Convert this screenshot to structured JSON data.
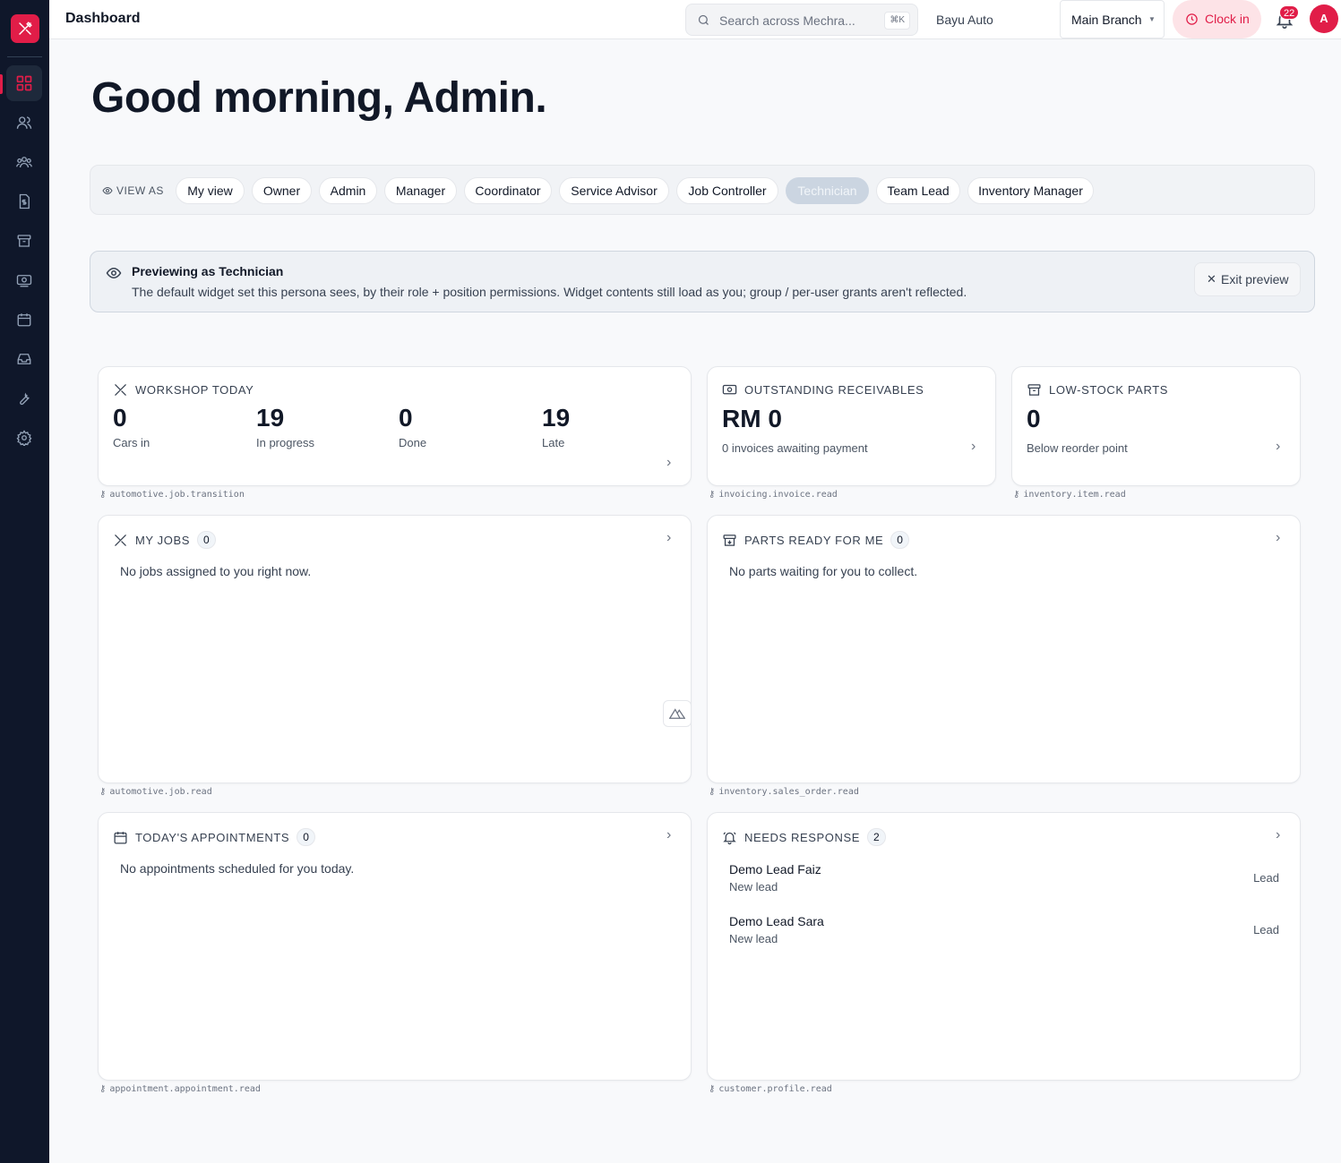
{
  "topbar": {
    "page_title": "Dashboard",
    "search_placeholder": "Search across Mechra...",
    "search_shortcut": "⌘K",
    "org_name": "Bayu Auto",
    "branch": "Main Branch",
    "clock_in": "Clock in",
    "notification_count": "22",
    "avatar_initial": "A"
  },
  "greeting": "Good morning, Admin.",
  "view_as": {
    "label": "VIEW AS",
    "personas": [
      "My view",
      "Owner",
      "Admin",
      "Manager",
      "Coordinator",
      "Service Advisor",
      "Job Controller",
      "Technician",
      "Team Lead",
      "Inventory Manager"
    ],
    "selected": "Technician"
  },
  "preview": {
    "title": "Previewing as Technician",
    "description": "The default widget set this persona sees, by their role + position permissions. Widget contents still load as you; group / per-user grants aren't reflected.",
    "exit_label": "Exit preview"
  },
  "widgets": {
    "workshop_today": {
      "title": "WORKSHOP TODAY",
      "stats": [
        {
          "value": "0",
          "label": "Cars in"
        },
        {
          "value": "19",
          "label": "In progress"
        },
        {
          "value": "0",
          "label": "Done"
        },
        {
          "value": "19",
          "label": "Late"
        }
      ],
      "permission": "automotive.job.transition"
    },
    "receivables": {
      "title": "OUTSTANDING RECEIVABLES",
      "value": "RM 0",
      "subtitle": "0 invoices awaiting payment",
      "permission": "invoicing.invoice.read"
    },
    "low_stock": {
      "title": "LOW-STOCK PARTS",
      "value": "0",
      "subtitle": "Below reorder point",
      "permission": "inventory.item.read"
    },
    "my_jobs": {
      "title": "MY JOBS",
      "count": "0",
      "empty": "No jobs assigned to you right now.",
      "permission": "automotive.job.read"
    },
    "parts_ready": {
      "title": "PARTS READY FOR ME",
      "count": "0",
      "empty": "No parts waiting for you to collect.",
      "permission": "inventory.sales_order.read"
    },
    "appointments": {
      "title": "TODAY'S APPOINTMENTS",
      "count": "0",
      "empty": "No appointments scheduled for you today.",
      "permission": "appointment.appointment.read"
    },
    "needs_response": {
      "title": "NEEDS RESPONSE",
      "count": "2",
      "items": [
        {
          "name": "Demo Lead Faiz",
          "status": "New lead",
          "type": "Lead"
        },
        {
          "name": "Demo Lead Sara",
          "status": "New lead",
          "type": "Lead"
        }
      ],
      "permission": "customer.profile.read"
    }
  },
  "colors": {
    "brand": "#e11d48",
    "sidebar": "#0f172a"
  }
}
